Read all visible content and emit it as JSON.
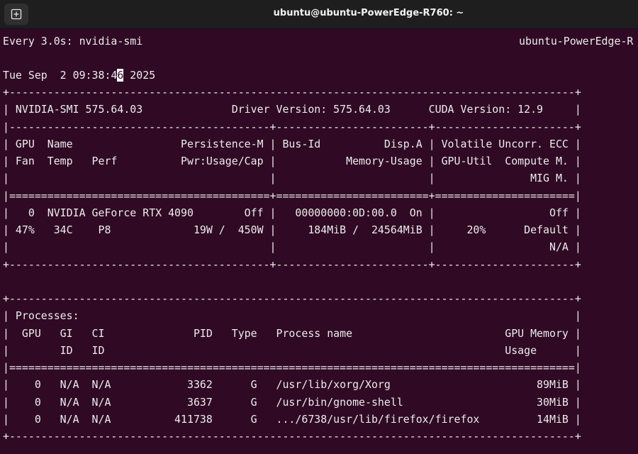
{
  "window": {
    "title": "ubuntu@ubuntu-PowerEdge-R760: ~",
    "new_tab_icon": "new-tab-icon"
  },
  "terminal": {
    "header_command": "Every 3.0s: nvidia-smi",
    "header_host": "ubuntu-PowerEdge-R",
    "timestamp_before_cursor": "Tue Sep  2 09:38:4",
    "timestamp_cursor_char": "6",
    "timestamp_after_cursor": " 2025",
    "lines": [
      "+-----------------------------------------------------------------------------------------+",
      "| NVIDIA-SMI 575.64.03              Driver Version: 575.64.03      CUDA Version: 12.9     |",
      "|-----------------------------------------+------------------------+----------------------+",
      "| GPU  Name                 Persistence-M | Bus-Id          Disp.A | Volatile Uncorr. ECC |",
      "| Fan  Temp   Perf          Pwr:Usage/Cap |           Memory-Usage | GPU-Util  Compute M. |",
      "|                                         |                        |               MIG M. |",
      "|=========================================+========================+======================|",
      "|   0  NVIDIA GeForce RTX 4090        Off |   00000000:0D:00.0  On |                  Off |",
      "| 47%   34C    P8             19W /  450W |     184MiB /  24564MiB |     20%      Default |",
      "|                                         |                        |                  N/A |",
      "+-----------------------------------------+------------------------+----------------------+",
      "",
      "+-----------------------------------------------------------------------------------------+",
      "| Processes:                                                                              |",
      "|  GPU   GI   CI              PID   Type   Process name                        GPU Memory |",
      "|        ID   ID                                                               Usage      |",
      "|=========================================================================================|",
      "|    0   N/A  N/A            3362      G   /usr/lib/xorg/Xorg                       89MiB |",
      "|    0   N/A  N/A            3637      G   /usr/bin/gnome-shell                     30MiB |",
      "|    0   N/A  N/A          411738      G   .../6738/usr/lib/firefox/firefox         14MiB |",
      "+-----------------------------------------------------------------------------------------+"
    ]
  }
}
